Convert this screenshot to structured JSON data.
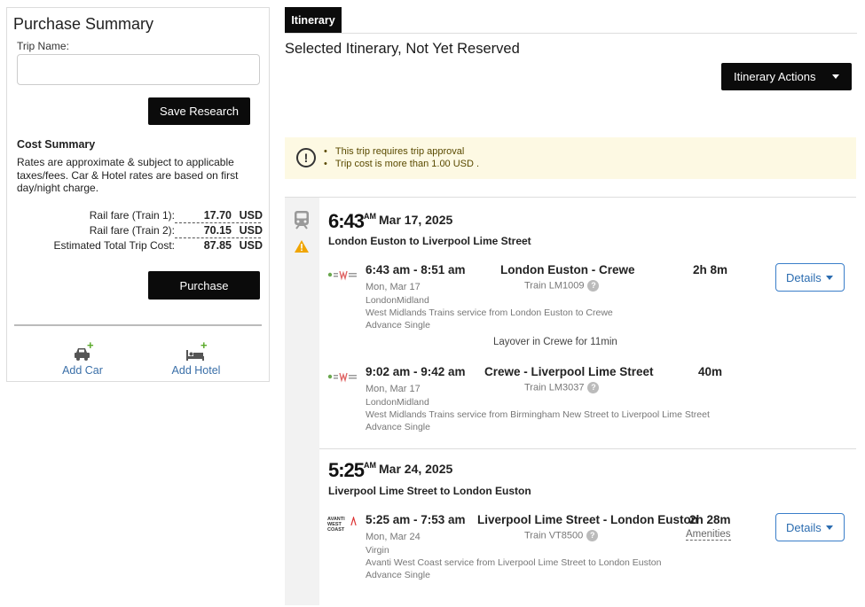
{
  "purchase_summary": {
    "title": "Purchase Summary",
    "trip_name_label": "Trip Name:",
    "trip_name_value": "",
    "save_button": "Save Research",
    "cost_summary_title": "Cost Summary",
    "cost_note": "Rates are approximate & subject to applicable taxes/fees. Car & Hotel rates are based on first day/night charge.",
    "rows": [
      {
        "label": "Rail fare (Train 1):",
        "amount": "17.70",
        "currency": "USD"
      },
      {
        "label": "Rail fare (Train 2):",
        "amount": "70.15",
        "currency": "USD"
      },
      {
        "label": "Estimated Total Trip Cost:",
        "amount": "87.85",
        "currency": "USD"
      }
    ],
    "purchase_button": "Purchase",
    "add_car": "Add Car",
    "add_hotel": "Add Hotel"
  },
  "tabs": [
    {
      "label": "Itinerary"
    }
  ],
  "itinerary": {
    "title": "Selected Itinerary, Not Yet Reserved",
    "actions_button": "Itinerary Actions",
    "alerts": [
      "This trip requires trip approval",
      "Trip cost is more than 1.00 USD ."
    ],
    "segments": [
      {
        "time": "6:43",
        "ampm": "AM",
        "date": "Mar 17, 2025",
        "route": "London Euston to Liverpool Lime Street",
        "legs": [
          {
            "times": "6:43 am - 8:51 am",
            "day": "Mon, Mar 17",
            "carrier": "LondonMidland",
            "description": "West Midlands Trains service from London Euston to Crewe",
            "fare": "Advance Single",
            "stations": "London Euston - Crewe",
            "train": "Train LM1009",
            "duration": "2h 8m",
            "details": "Details"
          },
          {
            "times": "9:02 am - 9:42 am",
            "day": "Mon, Mar 17",
            "carrier": "LondonMidland",
            "description": "West Midlands Trains service from Birmingham New Street to Liverpool Lime Street",
            "fare": "Advance Single",
            "stations": "Crewe - Liverpool Lime Street",
            "train": "Train LM3037",
            "duration": "40m"
          }
        ],
        "layover": "Layover in Crewe for 11min"
      },
      {
        "time": "5:25",
        "ampm": "AM",
        "date": "Mar 24, 2025",
        "route": "Liverpool Lime Street to London Euston",
        "legs": [
          {
            "times": "5:25 am - 7:53 am",
            "day": "Mon, Mar 24",
            "carrier": "Virgin",
            "description": "Avanti West Coast service from Liverpool Lime Street to London Euston",
            "fare": "Advance Single",
            "stations": "Liverpool Lime Street - London Euston",
            "train": "Train VT8500",
            "duration": "2h 28m",
            "amenities": "Amenities",
            "details": "Details",
            "logo_text": "AVANTI WEST COAST"
          }
        ]
      }
    ]
  },
  "colors": {
    "primary_button": "#0b0b0b",
    "link_blue": "#2b6cb0",
    "alert_bg": "#fdf9e3",
    "plus_green": "#5aaa2a",
    "warning": "#f0a500"
  },
  "icons": [
    "alert-circle-icon",
    "train-icon",
    "warning-icon",
    "car-icon",
    "bed-icon",
    "question-icon",
    "caret-down-icon"
  ]
}
